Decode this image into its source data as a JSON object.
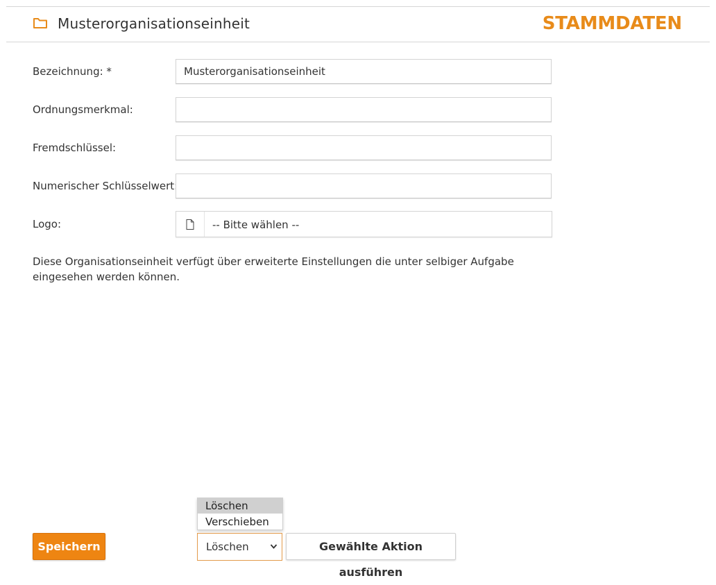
{
  "header": {
    "title": "Musterorganisationseinheit",
    "section": "STAMMDATEN",
    "accent_color": "#e88b1a",
    "icon": "folder-icon"
  },
  "form": {
    "bezeichnung": {
      "label": "Bezeichnung: *",
      "value": "Musterorganisationseinheit"
    },
    "ordnungsmerkmal": {
      "label": "Ordnungsmerkmal:",
      "value": ""
    },
    "fremdschluessel": {
      "label": "Fremdschlüssel:",
      "value": ""
    },
    "numerischer_schluesselwert": {
      "label": "Numerischer Schlüsselwert:",
      "value": ""
    },
    "logo": {
      "label": "Logo:",
      "value": "-- Bitte wählen --",
      "icon": "file-icon"
    }
  },
  "info_text": "Diese Organisationseinheit verfügt über erweiterte Einstellungen die unter selbiger Aufgabe eingesehen werden können.",
  "footer": {
    "save_label": "Speichern",
    "save_color": "#ee8512",
    "action_select": {
      "selected": "Löschen",
      "options": [
        "Löschen",
        "Verschieben"
      ]
    },
    "execute_label": "Gewählte Aktion ausführen"
  }
}
